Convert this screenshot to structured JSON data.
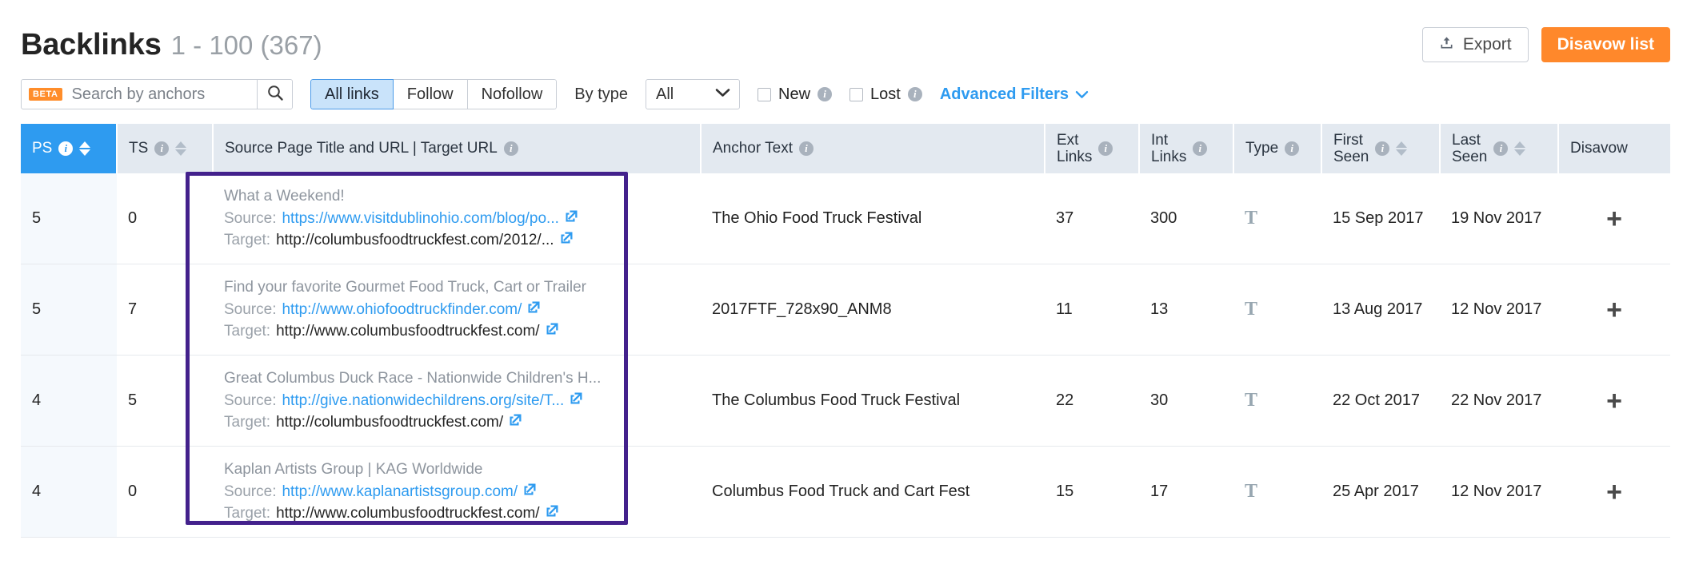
{
  "header": {
    "title": "Backlinks",
    "count_range": "1 - 100 (367)",
    "export_label": "Export",
    "disavow_label": "Disavow list"
  },
  "toolbar": {
    "beta_badge": "BETA",
    "search_placeholder": "Search by anchors",
    "search_value": "",
    "segments": [
      {
        "label": "All links",
        "active": true
      },
      {
        "label": "Follow",
        "active": false
      },
      {
        "label": "Nofollow",
        "active": false
      }
    ],
    "by_type_label": "By type",
    "by_type_value": "All",
    "by_type_options": [
      "All"
    ],
    "new_label": "New",
    "new_checked": false,
    "lost_label": "Lost",
    "lost_checked": false,
    "advanced_filters_label": "Advanced Filters"
  },
  "table": {
    "columns": [
      {
        "label": "PS",
        "info": true,
        "sortable": true,
        "active": true
      },
      {
        "label": "TS",
        "info": true,
        "sortable": true,
        "active": false
      },
      {
        "label": "Source Page Title and URL | Target URL",
        "info": true,
        "sortable": false,
        "active": false
      },
      {
        "label": "Anchor Text",
        "info": true,
        "sortable": false,
        "active": false
      },
      {
        "label": "Ext\nLinks",
        "info": true,
        "sortable": false,
        "active": false
      },
      {
        "label": "Int\nLinks",
        "info": true,
        "sortable": false,
        "active": false
      },
      {
        "label": "Type",
        "info": true,
        "sortable": false,
        "active": false
      },
      {
        "label": "First\nSeen",
        "info": true,
        "sortable": true,
        "active": false
      },
      {
        "label": "Last\nSeen",
        "info": true,
        "sortable": true,
        "active": false
      },
      {
        "label": "Disavow",
        "info": false,
        "sortable": false,
        "active": false
      }
    ],
    "column_labels": {
      "ps": "PS",
      "ts": "TS",
      "source": "Source Page Title and URL | Target URL",
      "anchor": "Anchor Text",
      "ext_links_l1": "Ext",
      "ext_links_l2": "Links",
      "int_links_l1": "Int",
      "int_links_l2": "Links",
      "type": "Type",
      "first_seen_l1": "First",
      "first_seen_l2": "Seen",
      "last_seen_l1": "Last",
      "last_seen_l2": "Seen",
      "disavow": "Disavow"
    },
    "source_prefix": "Source:",
    "target_prefix": "Target:",
    "rows": [
      {
        "ps": "5",
        "ts": "0",
        "title": "What a Weekend!",
        "source_url": "https://www.visitdublinohio.com/blog/po...",
        "target_url": "http://columbusfoodtruckfest.com/2012/...",
        "anchor": "The Ohio Food Truck Festival",
        "ext_links": "37",
        "int_links": "300",
        "type": "T",
        "first_seen": "15 Sep 2017",
        "last_seen": "19 Nov 2017",
        "disavow": "+"
      },
      {
        "ps": "5",
        "ts": "7",
        "title": "Find your favorite Gourmet Food Truck, Cart or Trailer",
        "source_url": "http://www.ohiofoodtruckfinder.com/",
        "target_url": "http://www.columbusfoodtruckfest.com/",
        "anchor": "2017FTF_728x90_ANM8",
        "ext_links": "11",
        "int_links": "13",
        "type": "T",
        "first_seen": "13 Aug 2017",
        "last_seen": "12 Nov 2017",
        "disavow": "+"
      },
      {
        "ps": "4",
        "ts": "5",
        "title": "Great Columbus Duck Race - Nationwide Children's H...",
        "source_url": "http://give.nationwidechildrens.org/site/T...",
        "target_url": "http://columbusfoodtruckfest.com/",
        "anchor": "The Columbus Food Truck Festival",
        "ext_links": "22",
        "int_links": "30",
        "type": "T",
        "first_seen": "22 Oct 2017",
        "last_seen": "22 Nov 2017",
        "disavow": "+"
      },
      {
        "ps": "4",
        "ts": "0",
        "title": "Kaplan Artists Group | KAG Worldwide",
        "source_url": "http://www.kaplanartistsgroup.com/",
        "target_url": "http://www.columbusfoodtruckfest.com/",
        "anchor": "Columbus Food Truck and Cart Fest",
        "ext_links": "15",
        "int_links": "17",
        "type": "T",
        "first_seen": "25 Apr 2017",
        "last_seen": "12 Nov 2017",
        "disavow": "+"
      }
    ]
  },
  "annotation": {
    "color": "#43218c",
    "description": "highlight-box-around-source-target-url-column"
  },
  "colors": {
    "accent_blue": "#2e9bf0",
    "brand_orange": "#ff882b",
    "header_bg": "#e3e9f0",
    "annotation_purple": "#43218c"
  }
}
